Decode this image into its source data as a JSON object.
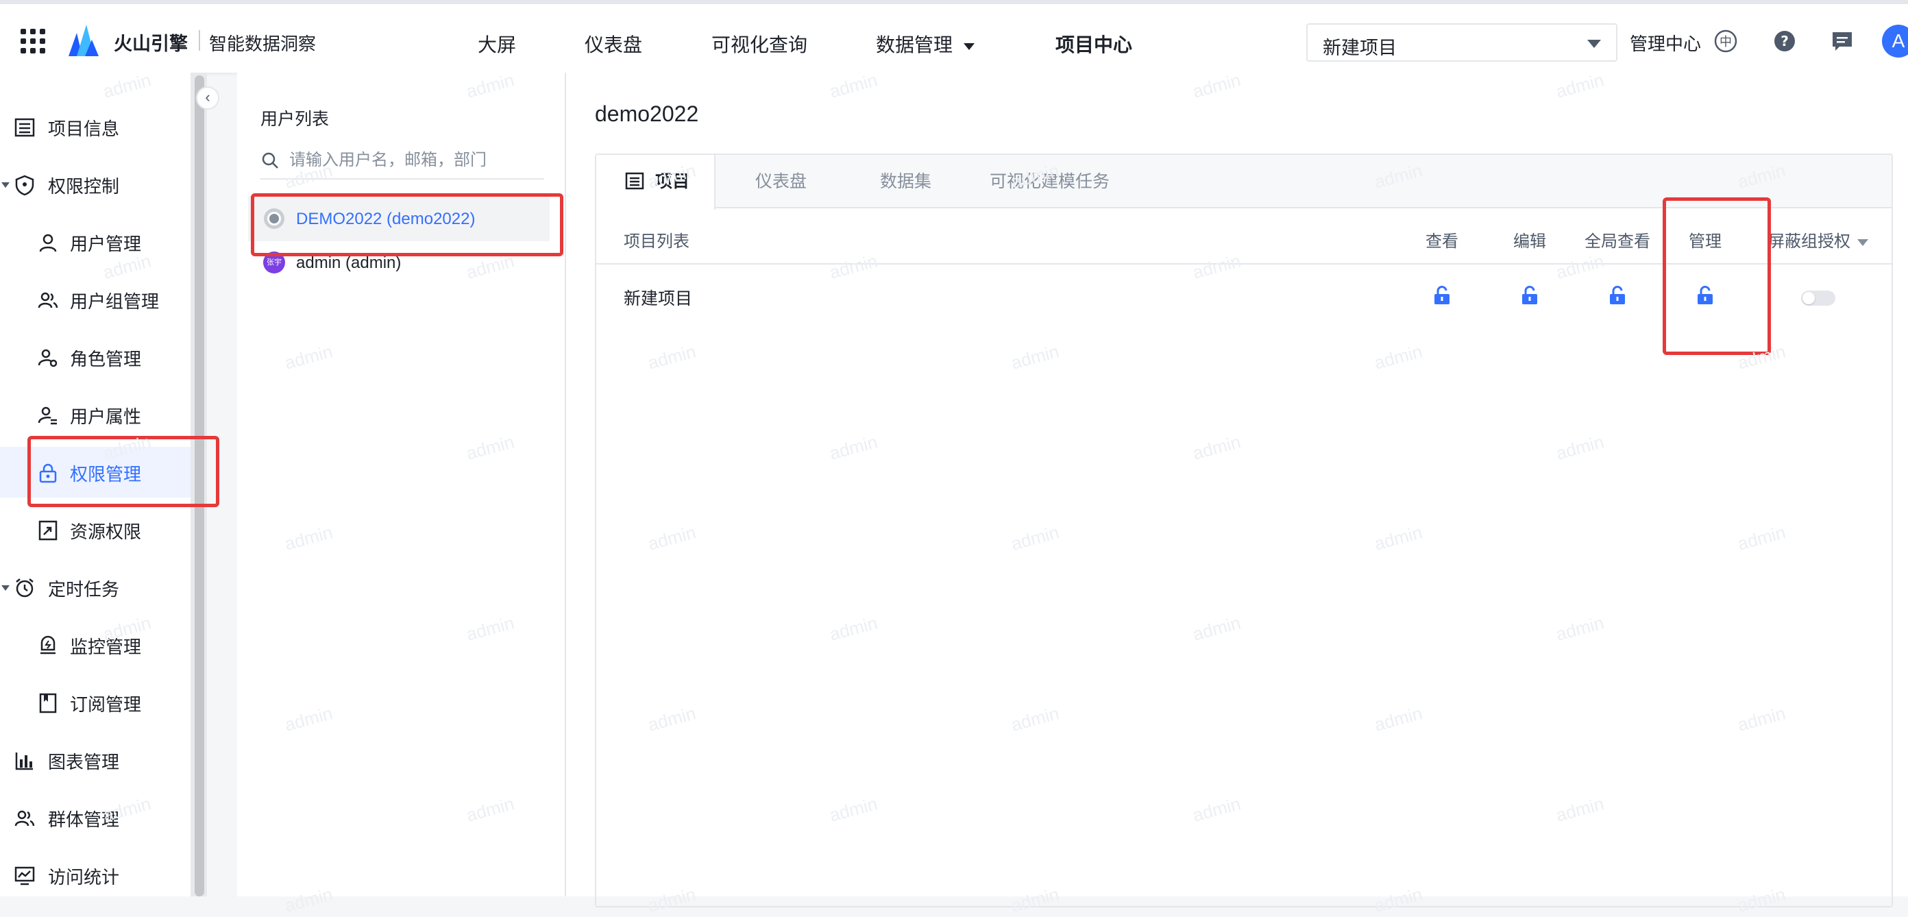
{
  "header": {
    "brand": "火山引擎",
    "product": "智能数据洞察",
    "nav": [
      "大屏",
      "仪表盘",
      "可视化查询",
      "数据管理",
      "项目中心"
    ],
    "project_select": "新建项目",
    "manage_center": "管理中心",
    "avatar_letter": "A",
    "icons": [
      "apps-grid-icon",
      "volcano-logo-icon",
      "translate-icon",
      "help-icon",
      "message-icon"
    ]
  },
  "sidebar": {
    "items": [
      {
        "label": "项目信息",
        "icon": "list-icon"
      },
      {
        "label": "权限控制",
        "icon": "shield-icon",
        "expanded": true
      },
      {
        "label": "用户管理",
        "icon": "user-icon"
      },
      {
        "label": "用户组管理",
        "icon": "user-group-icon"
      },
      {
        "label": "角色管理",
        "icon": "user-settings-icon"
      },
      {
        "label": "用户属性",
        "icon": "user-attribute-icon"
      },
      {
        "label": "权限管理",
        "icon": "lock-icon",
        "active": true
      },
      {
        "label": "资源权限",
        "icon": "resource-icon"
      },
      {
        "label": "定时任务",
        "icon": "clock-icon",
        "expanded": true
      },
      {
        "label": "监控管理",
        "icon": "monitor-icon"
      },
      {
        "label": "订阅管理",
        "icon": "bookmark-icon"
      },
      {
        "label": "图表管理",
        "icon": "bar-chart-icon"
      },
      {
        "label": "群体管理",
        "icon": "people-icon"
      },
      {
        "label": "访问统计",
        "icon": "stats-icon"
      }
    ]
  },
  "user_panel": {
    "title": "用户列表",
    "search_placeholder": "请输入用户名，邮箱，部门",
    "users": [
      {
        "name": "DEMO2022 (demo2022)",
        "selected": true
      },
      {
        "name": "admin (admin)",
        "avatar_text": "张宇",
        "selected": false
      }
    ]
  },
  "main": {
    "title": "demo2022",
    "tabs": [
      "项目",
      "仪表盘",
      "数据集",
      "可视化建模任务"
    ],
    "columns": {
      "list": "项目列表",
      "view": "查看",
      "edit": "编辑",
      "global_view": "全局查看",
      "manage": "管理",
      "block": "屏蔽组授权"
    },
    "rows": [
      {
        "name": "新建项目",
        "view": "unlocked",
        "edit": "unlocked",
        "global_view": "unlocked",
        "manage": "unlocked",
        "block_group_auth": false
      }
    ]
  },
  "watermark": "admin",
  "colors": {
    "accent": "#3370ff",
    "highlight": "#e5393a"
  }
}
